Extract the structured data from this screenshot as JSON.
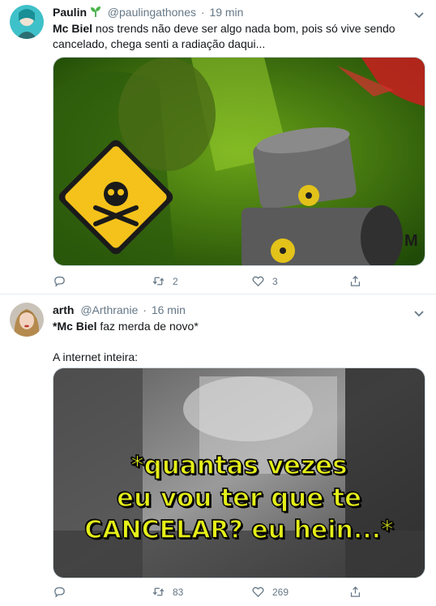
{
  "tweets": [
    {
      "name": "Paulin",
      "handle": "@paulingathones",
      "sep": "·",
      "time": "19 min",
      "text_bold": "Mc Biel",
      "text_rest": " nos trends não deve ser algo nada bom, pois só vive sendo cancelado, chega senti a radiação daqui...",
      "retweets": "2",
      "likes": "3"
    },
    {
      "name": "arth",
      "handle": "@Arthranie",
      "sep": "·",
      "time": "16 min",
      "text_prefix": "*",
      "text_bold": "Mc Biel",
      "text_rest": " faz merda de novo*",
      "line2": "A internet inteira:",
      "meme_line1": "*quantas vezes",
      "meme_line2": "eu vou ter que te",
      "meme_line3": "CANCELAR? eu hein...*",
      "retweets": "83",
      "likes": "269"
    }
  ],
  "colors": {
    "meta": "#657786",
    "divider": "#e6ecf0",
    "meme_text": "#e5ef18"
  },
  "icons": [
    "sprout-icon",
    "chevron-down-icon",
    "reply-icon",
    "retweet-icon",
    "like-icon",
    "share-icon"
  ]
}
